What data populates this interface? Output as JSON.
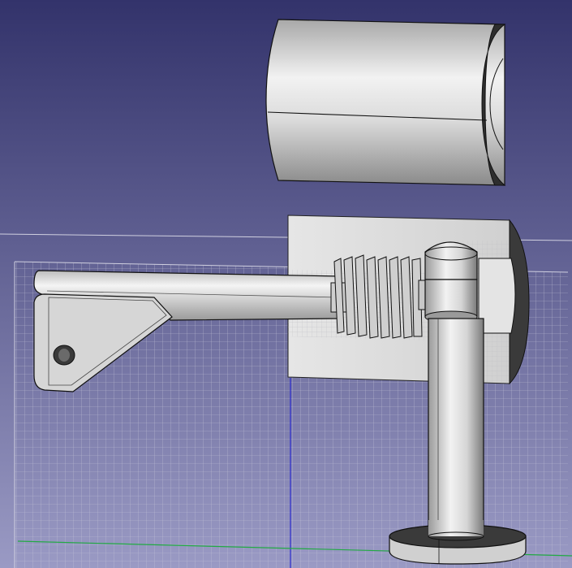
{
  "viewport": {
    "background_top": "#33336b",
    "background_bottom": "#9a9ac4",
    "grid_line_color": "#c8c8dc",
    "y_axis_color": "#2a2acc",
    "x_axis_color": "#22aa44",
    "part_face_color": "#d9d9d9",
    "part_edge_color": "#111111"
  },
  "scene": {
    "parts": [
      {
        "name": "cylinder-housing"
      },
      {
        "name": "mounting-plate"
      },
      {
        "name": "crank-handle"
      },
      {
        "name": "worm-screw"
      },
      {
        "name": "vertical-shaft"
      },
      {
        "name": "base-disc"
      }
    ]
  }
}
